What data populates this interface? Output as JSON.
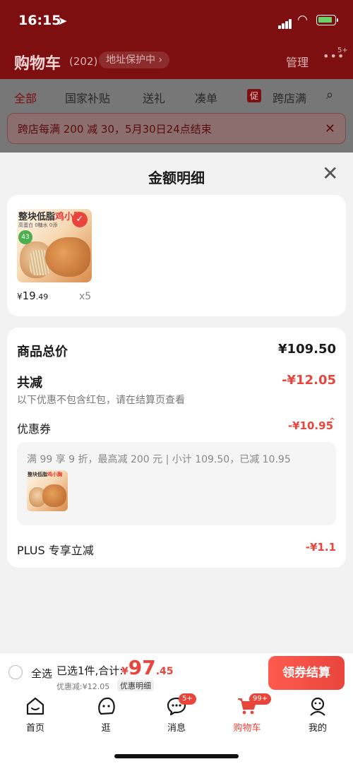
{
  "status_bar": {
    "time": "16:15",
    "location_icon": "location-arrow-icon"
  },
  "cart_header": {
    "title": "购物车",
    "count": "(202)",
    "address_protect": "地址保护中 ›",
    "manage": "管理",
    "more_badge": "5+"
  },
  "filter_tabs": [
    {
      "label": "全部",
      "active": true
    },
    {
      "label": "国家补贴"
    },
    {
      "label": "送礼"
    },
    {
      "label": "凑单"
    },
    {
      "label": "跨店满",
      "tag": "促"
    }
  ],
  "promo_banner": {
    "text": "跨店每满 200 减 30，5月30日24点结束"
  },
  "sheet": {
    "title": "金额明细",
    "product": {
      "image_title_a": "整块低脂",
      "image_title_b": "鸡小胸",
      "image_sub": "高蛋白  0糖水  0添",
      "image_badge": "43",
      "price_symbol": "¥",
      "price_int": "19",
      "price_dec": ".49",
      "qty": "x5"
    },
    "summary": {
      "goods_total_label": "商品总价",
      "goods_total_value": "¥109.50",
      "reduce_label": "共减",
      "reduce_value": "-¥12.05",
      "note": "以下优惠不包含红包，请在结算页查看",
      "coupon_label": "优惠券",
      "coupon_value": "-¥10.95",
      "coupon_desc": "满 99 享 9 折，最高减 200 元 | 小计 109.50，已减 10.95",
      "mini_title_a": "整块低脂",
      "mini_title_b": "鸡小胸",
      "plus_label": "PLUS 专享立减",
      "plus_value": "-¥1.1"
    }
  },
  "checkout_bar": {
    "select_all": "全选",
    "selected_info": "已选1件,合计:",
    "total_symbol": "¥",
    "total_int": "97",
    "total_dec": ".45",
    "discount_line": "优惠减:¥12.05",
    "detail_link": "优惠明细",
    "checkout_button": "领券结算"
  },
  "tab_bar": [
    {
      "label": "首页",
      "icon": "home-icon"
    },
    {
      "label": "逛",
      "icon": "browse-face-icon"
    },
    {
      "label": "消息",
      "icon": "message-icon",
      "badge": "5+"
    },
    {
      "label": "购物车",
      "icon": "cart-icon",
      "badge": "99+",
      "active": true
    },
    {
      "label": "我的",
      "icon": "profile-icon"
    }
  ],
  "colors": {
    "accent": "#e8453c",
    "header_dim": "#7d0f10"
  }
}
